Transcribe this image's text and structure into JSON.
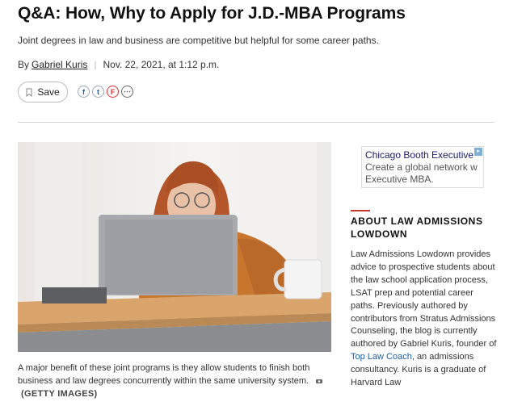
{
  "article": {
    "headline": "Q&A: How, Why to Apply for J.D.-MBA Programs",
    "subheadline": "Joint degrees in law and business are competitive but helpful for some career paths.",
    "by_prefix": "By",
    "author": "Gabriel Kuris",
    "date": "Nov. 22, 2021, at 1:12 p.m."
  },
  "actions": {
    "save_label": "Save",
    "share": [
      {
        "name": "facebook-icon",
        "glyph": "f"
      },
      {
        "name": "twitter-icon",
        "glyph": "t"
      },
      {
        "name": "flipboard-icon",
        "glyph": "F"
      },
      {
        "name": "more-icon",
        "glyph": "⋯"
      }
    ]
  },
  "photo": {
    "caption": "A major benefit of these joint programs is they allow students to finish both business and law degrees concurrently within the same university system.",
    "credit": "(GETTY IMAGES)"
  },
  "ad": {
    "title": "Chicago Booth Executive",
    "body_line1": "Create a global network w",
    "body_line2": "Executive MBA."
  },
  "sidebar": {
    "about_title": "ABOUT LAW ADMISSIONS LOWDOWN",
    "about_text_1": "Law Admissions Lowdown provides advice to prospective students about the law school application process, LSAT prep and potential career paths. Previously authored by contributors from Stratus Admissions Counseling, the blog is currently authored by Gabriel Kuris, founder of ",
    "about_link": "Top Law Coach",
    "about_text_2": ", an admissions consultancy. Kuris is a graduate of Harvard Law"
  },
  "colors": {
    "accent": "#c0392b",
    "link": "#1a5fa8"
  }
}
